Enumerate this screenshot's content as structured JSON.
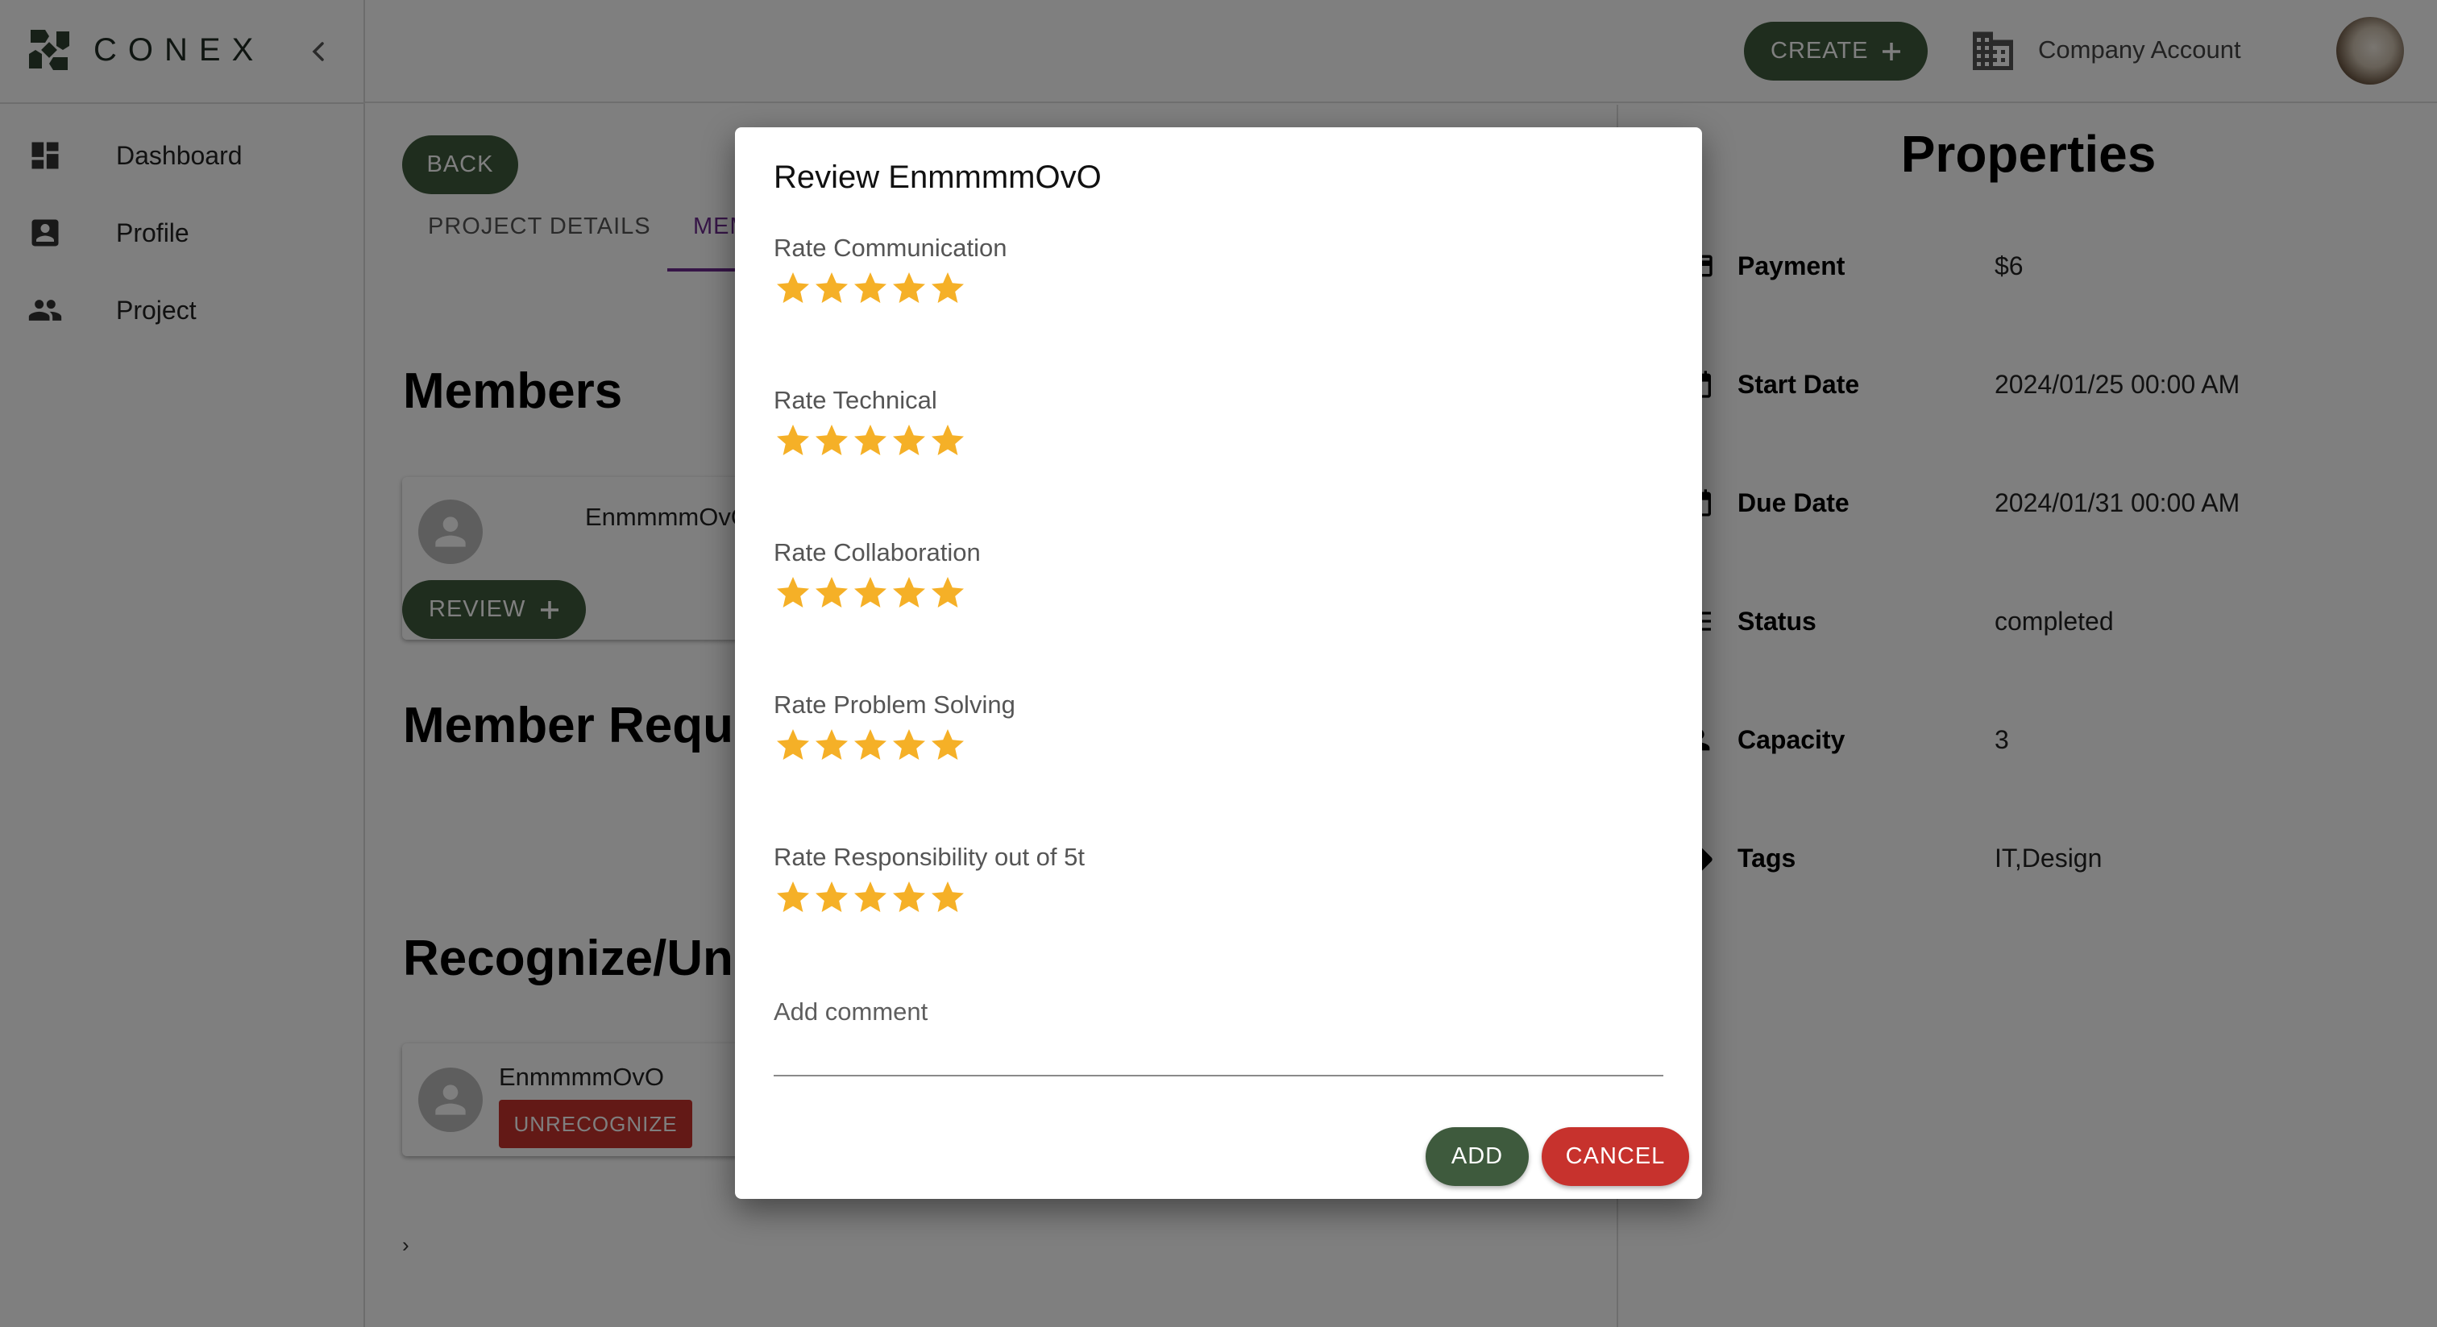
{
  "app": {
    "logo_text": "CONEX",
    "accent_color": "#3e5a3d",
    "danger_color": "#c7322d",
    "tab_active_color": "#6c2a8f",
    "star_color": "#f5b027"
  },
  "sidebar": {
    "items": [
      {
        "label": "Dashboard",
        "icon": "dashboard-icon"
      },
      {
        "label": "Profile",
        "icon": "profile-icon"
      },
      {
        "label": "Project",
        "icon": "people-icon"
      }
    ]
  },
  "topbar": {
    "create_label": "CREATE",
    "company_label": "Company Account"
  },
  "main": {
    "back_label": "BACK",
    "tabs": [
      {
        "label": "PROJECT DETAILS"
      },
      {
        "label": "MEMBERS"
      }
    ],
    "members_heading": "Members",
    "member_name": "EnmmmmOvO",
    "review_label": "REVIEW",
    "member_requests_heading": "Member Requests",
    "recognize_heading": "Recognize/Unrecognize",
    "recognized_name": "EnmmmmOvO",
    "unrecognize_label": "UNRECOGNIZE",
    "footer_mark": "›"
  },
  "properties": {
    "title": "Properties",
    "rows": [
      {
        "key": "Payment",
        "value": "$6"
      },
      {
        "key": "Start Date",
        "value": "2024/01/25 00:00 AM"
      },
      {
        "key": "Due Date",
        "value": "2024/01/31 00:00 AM"
      },
      {
        "key": "Status",
        "value": "completed"
      },
      {
        "key": "Capacity",
        "value": "3"
      },
      {
        "key": "Tags",
        "value": "IT,Design"
      }
    ]
  },
  "modal": {
    "title": "Review EnmmmmOvO",
    "ratings": [
      {
        "label": "Rate Communication",
        "stars": 5,
        "max": 5
      },
      {
        "label": "Rate Technical",
        "stars": 5,
        "max": 5
      },
      {
        "label": "Rate Collaboration",
        "stars": 5,
        "max": 5
      },
      {
        "label": "Rate Problem Solving",
        "stars": 5,
        "max": 5
      },
      {
        "label": "Rate Responsibility out of 5t",
        "stars": 5,
        "max": 5
      }
    ],
    "comment_placeholder": "Add comment",
    "comment_value": "",
    "add_label": "ADD",
    "cancel_label": "CANCEL"
  }
}
